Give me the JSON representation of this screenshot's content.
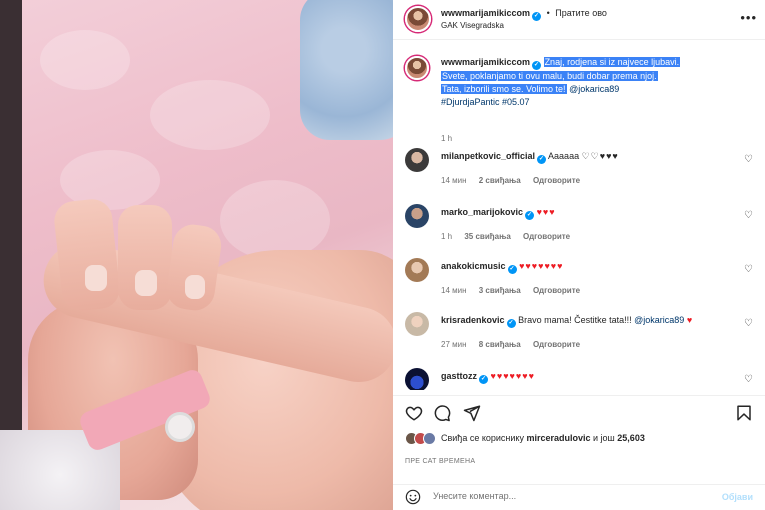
{
  "post": {
    "author": "wwwmarijamikiccom",
    "follow_label": "Пратите ово",
    "location": "GAK Visegradska",
    "more_label": "•••"
  },
  "caption": {
    "username": "wwwmarijamikiccom",
    "text_line1": "Znaj, rodjena si iz najvece ljubavi.",
    "text_line2": "Svete, poklanjamo ti ovu malu, budi dobar prema njoj.",
    "text_line3": "Tata, izborili smo se. Volimo te!",
    "mention": "@jokarica89",
    "tags": "#DjurdjaPantic #05.07",
    "time": "1 h"
  },
  "comments": [
    {
      "username": "milanpetkovic_official",
      "text": "Aaaaaa",
      "hearts": "♡♡♥♥♥",
      "time": "14 мин",
      "likes": "2 свиђања",
      "reply": "Одговорите"
    },
    {
      "username": "marko_marijokovic",
      "text": "",
      "hearts": "♥♥♥",
      "time": "1 h",
      "likes": "35 свиђања",
      "reply": "Одговорите"
    },
    {
      "username": "anakokicmusic",
      "text": "",
      "hearts": "♥♥♥♥♥♥♥",
      "time": "14 мин",
      "likes": "3 свиђања",
      "reply": "Одговорите"
    },
    {
      "username": "krisradenkovic",
      "text": "Bravo mama! Čestitke tata!!!",
      "mention": "@jokarica89",
      "hearts": "♥",
      "time": "27 мин",
      "likes": "8 свиђања",
      "reply": "Одговорите"
    },
    {
      "username": "gasttozz",
      "text": "",
      "hearts": "♥♥♥♥♥♥♥",
      "time": "",
      "likes": "",
      "reply": ""
    }
  ],
  "likes": {
    "prefix": "Свиђа се кориснику",
    "user": "mirceradulovic",
    "middle": "и још",
    "count": "25,603"
  },
  "time_ago": "ПРЕ САТ ВРЕМЕНА",
  "comment_box": {
    "placeholder": "Унесите коментар...",
    "post_label": "Објави"
  },
  "colors": {
    "accent": "#0095f6",
    "heart_red": "#ed1c24",
    "selection": "#3b82f6"
  },
  "icons": [
    "heart-icon",
    "comment-icon",
    "share-icon",
    "bookmark-icon",
    "emoji-icon",
    "verified-icon"
  ]
}
